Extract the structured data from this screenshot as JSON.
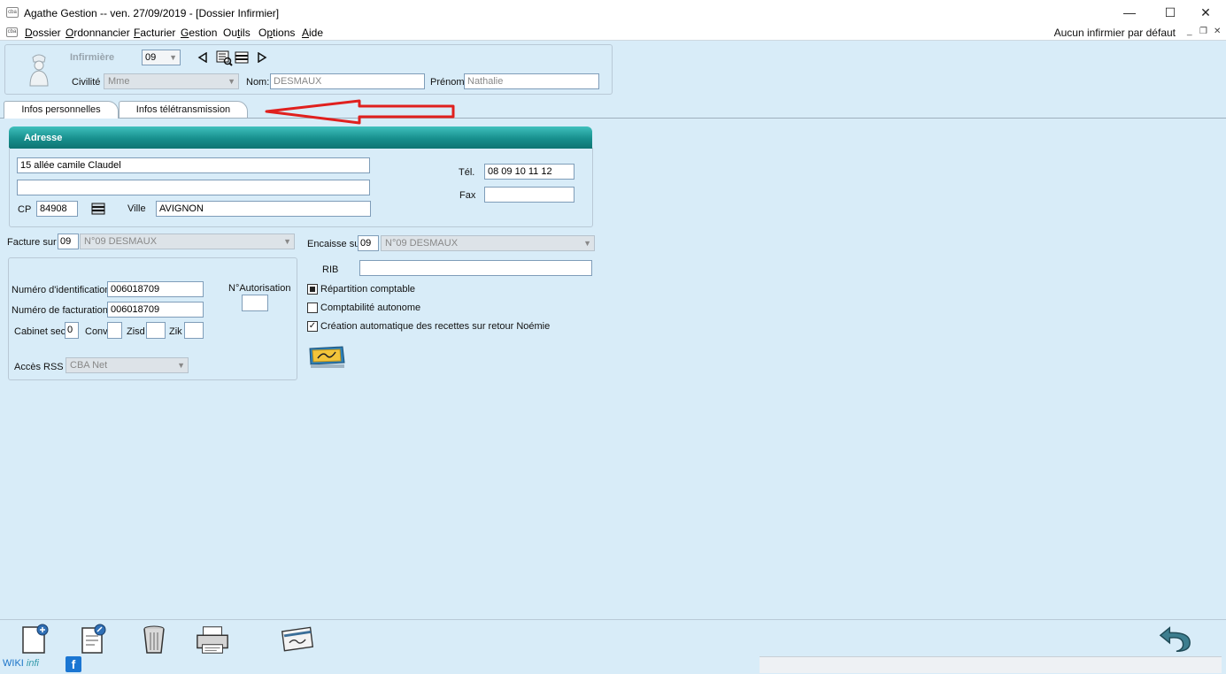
{
  "window": {
    "title": "Agathe Gestion   --   ven. 27/09/2019  - [Dossier Infirmier]",
    "app_icon_text": "cba",
    "minimize": "—",
    "maximize": "☐",
    "close": "✕"
  },
  "menu": {
    "items": [
      {
        "pre": "",
        "ul": "D",
        "post": "ossier"
      },
      {
        "pre": "",
        "ul": "O",
        "post": "rdonnancier"
      },
      {
        "pre": "",
        "ul": "F",
        "post": "acturier"
      },
      {
        "pre": "",
        "ul": "G",
        "post": "estion"
      },
      {
        "pre": "Ou",
        "ul": "t",
        "post": "ils"
      },
      {
        "pre": "O",
        "ul": "p",
        "post": "tions"
      },
      {
        "pre": "",
        "ul": "A",
        "post": "ide"
      }
    ],
    "default_nurse": "Aucun infirmier par défaut",
    "mdi_min": "_",
    "mdi_restore": "❐",
    "mdi_close": "✕"
  },
  "header": {
    "title_label": "Infirmière",
    "number": "09",
    "civilite_label": "Civilité",
    "civilite_value": "Mme",
    "nom_label": "Nom:",
    "nom_value": "DESMAUX",
    "prenom_label": "Prénom",
    "prenom_value": "Nathalie"
  },
  "tabs": {
    "perso": "Infos personnelles",
    "tele": "Infos télétransmission"
  },
  "address": {
    "header": "Adresse",
    "line1": "15 allée camile Claudel",
    "line2": "",
    "cp_label": "CP",
    "cp_value": "84908",
    "ville_label": "Ville",
    "ville_value": "AVIGNON",
    "tel_label": "Tél.",
    "tel_value": "08 09 10 11 12",
    "fax_label": "Fax",
    "fax_value": ""
  },
  "billing": {
    "facture_label": "Facture sur",
    "facture_num": "09",
    "facture_name": "N°09  DESMAUX",
    "encaisse_label": "Encaisse sur",
    "encaisse_num": "09",
    "encaisse_name": "N°09  DESMAUX",
    "rib_label": "RIB",
    "rib_value": ""
  },
  "ident": {
    "numero_ident_label": "Numéro d'identification",
    "numero_ident_value": "006018709",
    "numero_fact_label": "Numéro de facturation",
    "numero_fact_value": "006018709",
    "autorisation_label": "N°Autorisation",
    "autorisation_value": "",
    "cabinet_label": "Cabinet sec.",
    "cabinet_value": "0",
    "conv_label": "Conv",
    "conv_value": "",
    "zisd_label": "Zisd",
    "zisd_value": "",
    "zik_label": "Zik",
    "zik_value": "",
    "acces_rss_label": "Accès RSS",
    "acces_rss_value": "CBA Net"
  },
  "options": {
    "repartition": "Répartition comptable",
    "compta": "Comptabilité autonome",
    "creation": "Création automatique des recettes sur retour Noémie"
  },
  "footer": {
    "wiki": "WIKI",
    "wiki_suffix": "infi",
    "facebook": "f"
  }
}
